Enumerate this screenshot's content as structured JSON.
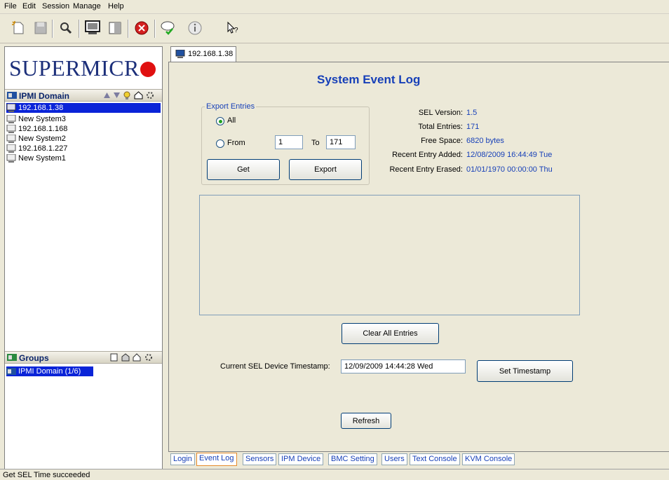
{
  "menu": [
    "File",
    "Edit",
    "Session",
    "Manage",
    "Help"
  ],
  "left": {
    "logo_text": "SUPERMICR",
    "domain_header": "IPMI Domain",
    "systems": [
      "192.168.1.38",
      "New System3",
      "192.168.1.168",
      "New System2",
      "192.168.1.227",
      "New System1"
    ],
    "selected_system": "192.168.1.38",
    "groups_header": "Groups",
    "groups": [
      "IPMI Domain (1/6)"
    ]
  },
  "session_tab": "192.168.1.38",
  "main": {
    "title": "System Event Log",
    "export": {
      "legend": "Export Entries",
      "all_label": "All",
      "from_label": "From",
      "from_value": "1",
      "to_label": "To",
      "to_value": "171",
      "get_button": "Get",
      "export_button": "Export"
    },
    "info": {
      "sel_version_label": "SEL Version:",
      "sel_version": "1.5",
      "total_entries_label": "Total Entries:",
      "total_entries": "171",
      "free_space_label": "Free Space:",
      "free_space": "6820 bytes",
      "recent_added_label": "Recent Entry Added:",
      "recent_added": "12/08/2009 16:44:49 Tue",
      "recent_erased_label": "Recent Entry Erased:",
      "recent_erased": "01/01/1970 00:00:00 Thu"
    },
    "clear_button": "Clear All Entries",
    "timestamp_label": "Current SEL Device Timestamp:",
    "timestamp_value": "12/09/2009 14:44:28 Wed",
    "set_timestamp_button": "Set Timestamp",
    "refresh_button": "Refresh"
  },
  "bottom_tabs": [
    "Login",
    "Event Log",
    "Sensors",
    "IPM Device",
    "BMC Setting",
    "Users",
    "Text Console",
    "KVM Console"
  ],
  "active_tab": "Event Log",
  "status": "Get SEL Time succeeded",
  "colors": {
    "accent": "#1740b8",
    "selection": "#0a24d8",
    "logo_red": "#e01010"
  }
}
